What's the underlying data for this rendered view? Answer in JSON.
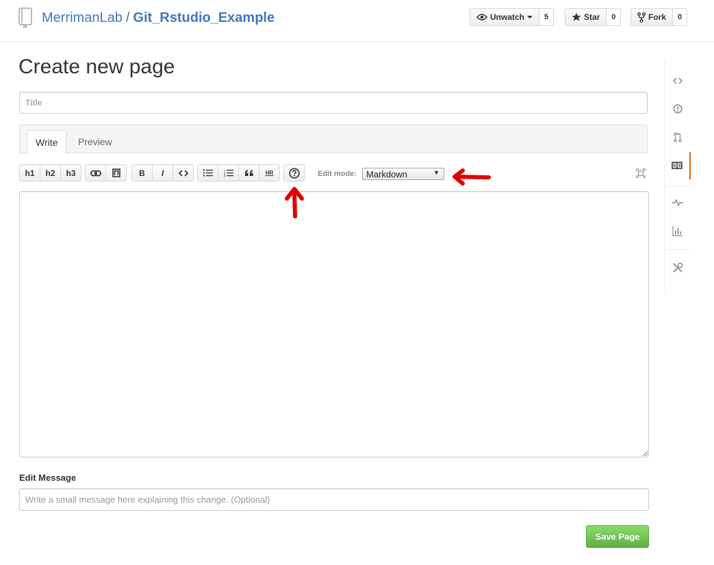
{
  "header": {
    "owner": "MerrimanLab",
    "separator": "/",
    "repo_name": "Git_Rstudio_Example",
    "repo_icon": "book-repo-icon",
    "watch": {
      "label": "Unwatch",
      "count": "5",
      "icon": "eye-icon"
    },
    "star": {
      "label": "Star",
      "count": "0",
      "icon": "star-icon"
    },
    "fork": {
      "label": "Fork",
      "count": "0",
      "icon": "fork-icon"
    }
  },
  "main": {
    "page_title": "Create new page",
    "title_input": {
      "placeholder": "Title",
      "value": ""
    },
    "tabs": [
      {
        "label": "Write",
        "active": true
      },
      {
        "label": "Preview",
        "active": false
      }
    ],
    "toolbar": {
      "headers": [
        "h1",
        "h2",
        "h3"
      ],
      "insert": [
        {
          "icon": "link-icon"
        },
        {
          "icon": "image-icon"
        }
      ],
      "format": [
        {
          "label": "B"
        },
        {
          "label": "I"
        },
        {
          "icon": "code-icon"
        }
      ],
      "lists": [
        {
          "icon": "unordered-list-icon"
        },
        {
          "icon": "ordered-list-icon"
        },
        {
          "icon": "quote-icon"
        },
        {
          "label": "HR"
        }
      ],
      "help_icon": "question-icon",
      "edit_mode_label": "Edit mode:",
      "edit_mode_value": "Markdown",
      "fullscreen_icon": "fullscreen-icon"
    },
    "editor_value": "",
    "edit_message_label": "Edit Message",
    "edit_message_placeholder": "Write a small message here explaining this change. (Optional)",
    "save_label": "Save Page"
  },
  "side_nav": [
    {
      "icon": "code-icon",
      "selected": false
    },
    {
      "icon": "issue-icon",
      "selected": false
    },
    {
      "icon": "pull-request-icon",
      "selected": false
    },
    {
      "icon": "wiki-book-icon",
      "selected": true
    },
    {
      "icon": "pulse-icon",
      "selected": false
    },
    {
      "icon": "graph-icon",
      "selected": false
    },
    {
      "icon": "settings-tools-icon",
      "selected": false
    }
  ],
  "colors": {
    "link_blue": "#4078c0",
    "save_green": "#60b044",
    "selected_nav_accent": "#d26911",
    "annotation_red": "#e00000"
  }
}
